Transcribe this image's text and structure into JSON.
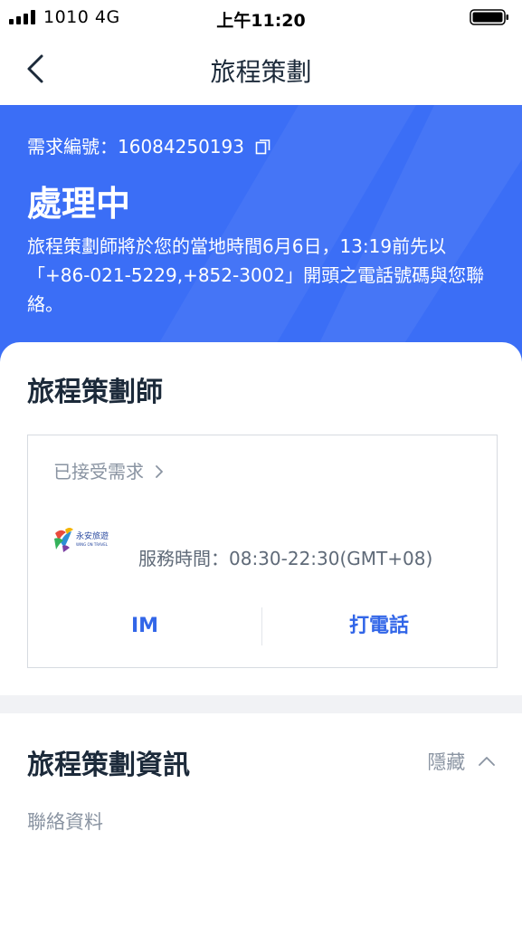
{
  "status_bar": {
    "carrier": "1010 4G",
    "time": "上午11:20"
  },
  "nav": {
    "title": "旅程策劃",
    "back_icon": "chevron-left-icon"
  },
  "header": {
    "background_color": "#3b6ef6",
    "request_label": "需求編號：",
    "request_number": "16084250193",
    "status": "處理中",
    "description": "旅程策劃師將於您的當地時間6月6日，13:19前先以「+86-021-5229,+852-3002」開頭之電話號碼與您聯絡。"
  },
  "planner": {
    "section_title": "旅程策劃師",
    "accepted_label": "已接受需求",
    "logo_text": "永安旅遊",
    "logo_subtext": "WING ON TRAVEL",
    "service_time": "服務時間：08:30-22:30(GMT+08)",
    "im_label": "IM",
    "call_label": "打電話",
    "accent_color": "#3266e8"
  },
  "info": {
    "section_title": "旅程策劃資訊",
    "hide_label": "隱藏",
    "contact_label": "聯絡資料"
  }
}
